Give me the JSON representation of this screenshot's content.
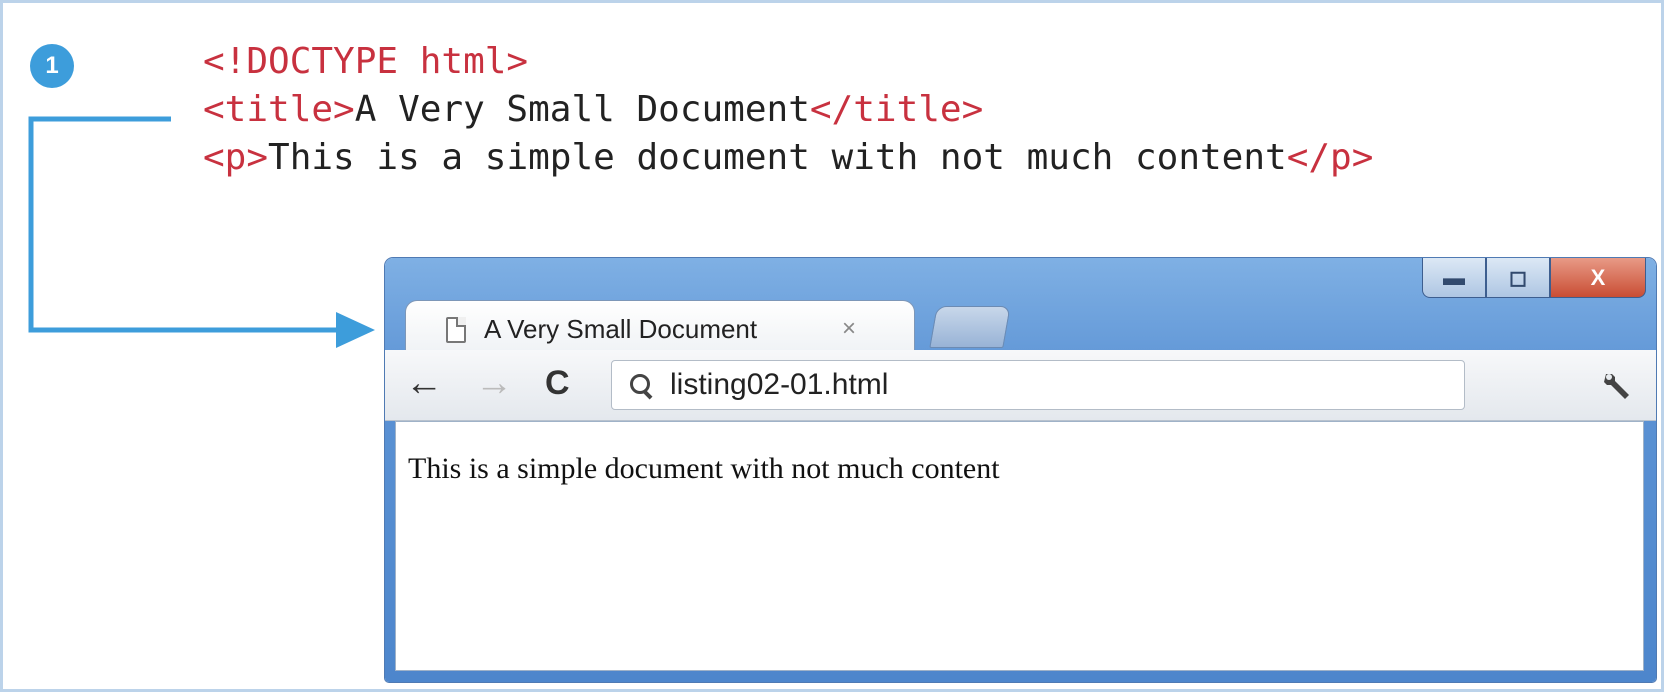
{
  "step": {
    "number": "1"
  },
  "code": {
    "line1": {
      "tag": "<!DOCTYPE html>"
    },
    "line2": {
      "open": "<title>",
      "text": "A Very Small Document",
      "close": "</title>"
    },
    "line3": {
      "open": "<p>",
      "text": "This is a simple document with not much content",
      "close": "</p>"
    }
  },
  "browser": {
    "tab": {
      "title": "A Very Small Document",
      "close_glyph": "×",
      "icon": "page-icon"
    },
    "window_controls": {
      "minimize": "▬",
      "maximize": "◻",
      "close": "X"
    },
    "toolbar": {
      "back": "←",
      "forward": "→",
      "reload": "C",
      "address": "listing02-01.html",
      "wrench": "🔧"
    },
    "content": {
      "paragraph": "This is a simple document with not much content"
    }
  },
  "colors": {
    "tag": "#c8313f",
    "accent": "#3d9ddb",
    "text": "#222222"
  }
}
